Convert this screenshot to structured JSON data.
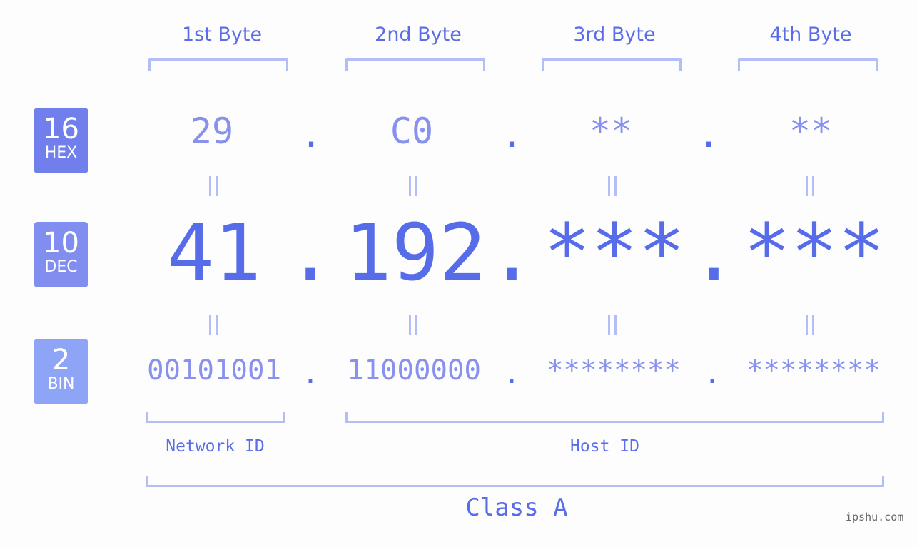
{
  "bytes": {
    "headers": [
      "1st Byte",
      "2nd Byte",
      "3rd Byte",
      "4th Byte"
    ]
  },
  "bases": [
    {
      "num": "16",
      "label": "HEX",
      "color": "#717fec"
    },
    {
      "num": "10",
      "label": "DEC",
      "color": "#818ef0"
    },
    {
      "num": "2",
      "label": "BIN",
      "color": "#8ea4f6"
    }
  ],
  "hex": [
    "29",
    "C0",
    "**",
    "**"
  ],
  "dec": [
    "41",
    "192",
    "***",
    "***"
  ],
  "bin": [
    "00101001",
    "11000000",
    "********",
    "********"
  ],
  "separator": ".",
  "groups": {
    "network": "Network ID",
    "host": "Host ID",
    "class": "Class A"
  },
  "watermark": "ipshu.com"
}
